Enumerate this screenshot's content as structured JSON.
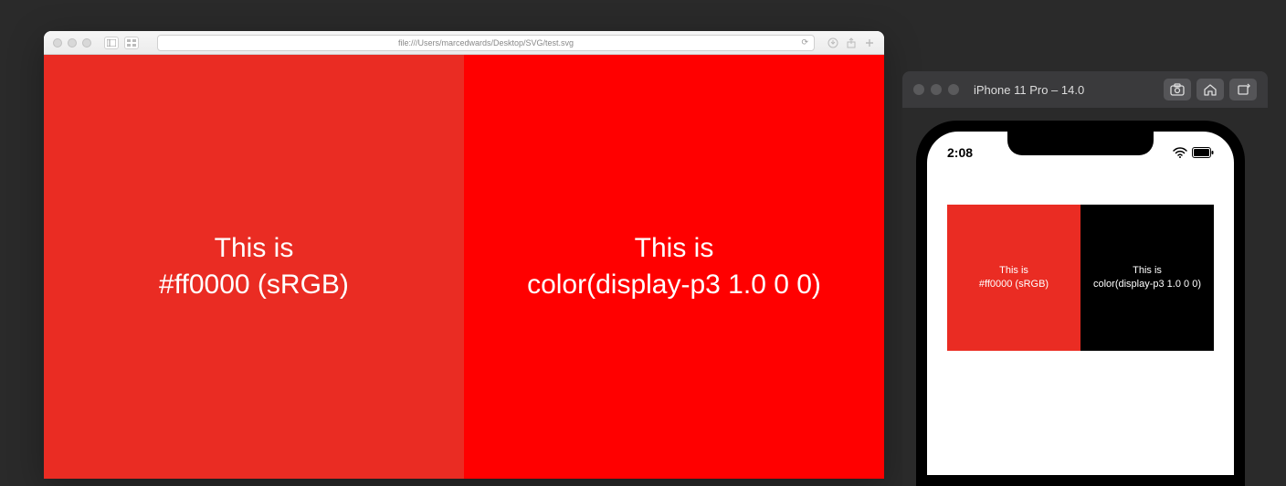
{
  "safari": {
    "address": "file:///Users/marcedwards/Desktop/SVG/test.svg",
    "swatch_left": {
      "line1": "This is",
      "line2": "#ff0000 (sRGB)",
      "color": "#ea2c23"
    },
    "swatch_right": {
      "line1": "This is",
      "line2": "color(display-p3 1.0 0 0)",
      "color": "#ff0000"
    }
  },
  "simulator": {
    "title": "iPhone 11 Pro – 14.0",
    "status_time": "2:08",
    "swatch_left": {
      "line1": "This is",
      "line2": "#ff0000 (sRGB)",
      "color": "#ea2c23"
    },
    "swatch_right": {
      "line1": "This is",
      "line2": "color(display-p3 1.0 0 0)",
      "color": "#000000"
    }
  }
}
